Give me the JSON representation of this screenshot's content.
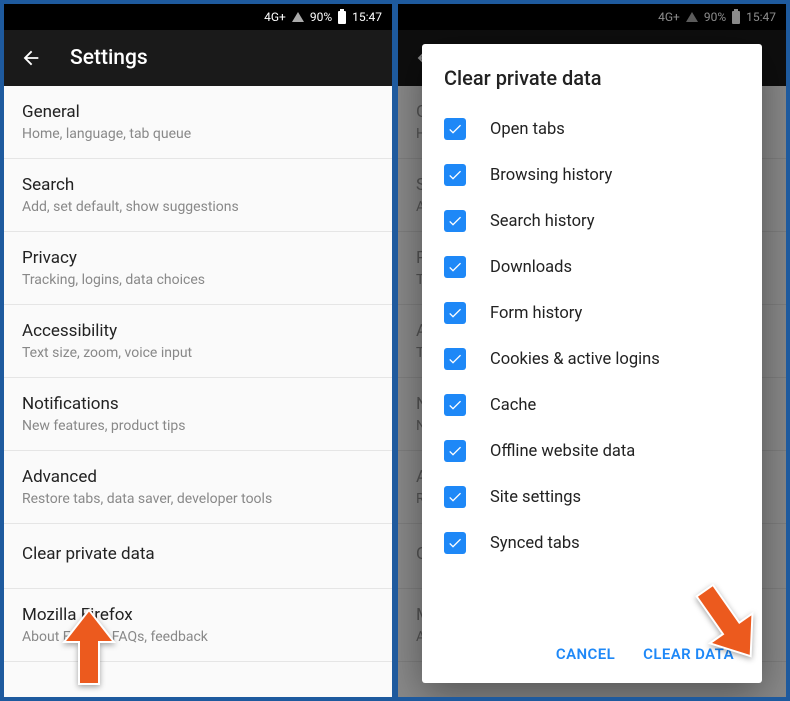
{
  "status": {
    "network": "4G+",
    "battery_pct": "90%",
    "time": "15:47"
  },
  "left": {
    "title": "Settings",
    "items": [
      {
        "primary": "General",
        "secondary": "Home, language, tab queue"
      },
      {
        "primary": "Search",
        "secondary": "Add, set default, show suggestions"
      },
      {
        "primary": "Privacy",
        "secondary": "Tracking, logins, data choices"
      },
      {
        "primary": "Accessibility",
        "secondary": "Text size, zoom, voice input"
      },
      {
        "primary": "Notifications",
        "secondary": "New features, product tips"
      },
      {
        "primary": "Advanced",
        "secondary": "Restore tabs, data saver, developer tools"
      },
      {
        "primary": "Clear private data",
        "secondary": ""
      },
      {
        "primary": "Mozilla Firefox",
        "secondary": "About Firefox, FAQs, feedback"
      }
    ]
  },
  "dialog": {
    "title": "Clear private data",
    "items": [
      "Open tabs",
      "Browsing history",
      "Search history",
      "Downloads",
      "Form history",
      "Cookies & active logins",
      "Cache",
      "Offline website data",
      "Site settings",
      "Synced tabs"
    ],
    "cancel": "CANCEL",
    "confirm": "CLEAR DATA"
  }
}
